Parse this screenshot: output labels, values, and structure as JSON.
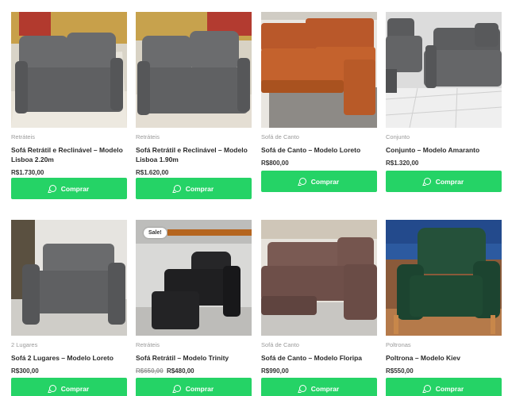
{
  "products": [
    {
      "category": "Retráteis",
      "title": "Sofá Retrátil e Reclinável – Modelo Lisboa 2.20m",
      "price": "R$1.730,00",
      "button": "Comprar"
    },
    {
      "category": "Retráteis",
      "title": "Sofá Retrátil e Reclinável – Modelo Lisboa 1.90m",
      "price": "R$1.620,00",
      "button": "Comprar"
    },
    {
      "category": "Sofá de Canto",
      "title": "Sofá de Canto – Modelo Loreto",
      "price": "R$800,00",
      "button": "Comprar"
    },
    {
      "category": "Conjunto",
      "title": "Conjunto – Modelo Amaranto",
      "price": "R$1.320,00",
      "button": "Comprar"
    },
    {
      "category": "2 Lugares",
      "title": "Sofá 2 Lugares – Modelo Loreto",
      "price": "R$300,00",
      "button": "Comprar"
    },
    {
      "category": "Retráteis",
      "title": "Sofá Retrátil – Modelo Trinity",
      "old_price": "R$650,00",
      "price": "R$480,00",
      "button": "Comprar",
      "badge": "Sale!"
    },
    {
      "category": "Sofá de Canto",
      "title": "Sofá de Canto – Modelo Floripa",
      "price": "R$990,00",
      "button": "Comprar"
    },
    {
      "category": "Poltronas",
      "title": "Poltrona – Modelo Kiev",
      "price": "R$550,00",
      "button": "Comprar"
    }
  ],
  "colors": {
    "button": "#25d366",
    "grey_sofa": "#5f6062",
    "orange_sofa": "#c4622d",
    "black_sofa": "#1f1f21",
    "brown_sofa": "#6e4f49",
    "green_chair": "#1f4a33"
  },
  "icons": {
    "button_icon": "whatsapp-icon"
  }
}
